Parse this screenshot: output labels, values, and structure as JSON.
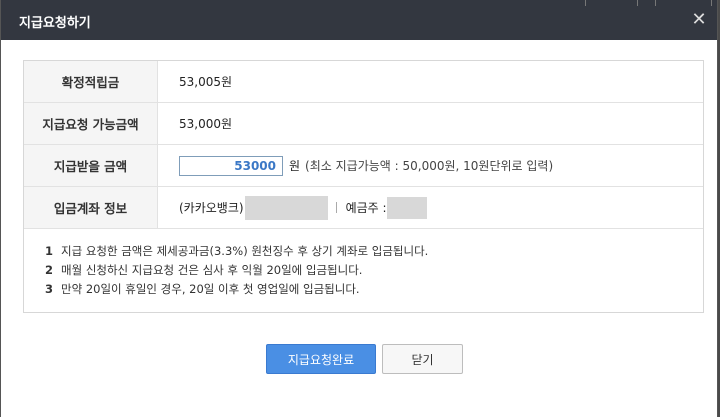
{
  "dialog": {
    "title": "지급요청하기",
    "close_icon": "close-icon"
  },
  "rows": {
    "confirmed": {
      "label": "확정적립금",
      "value": "53,005원"
    },
    "available": {
      "label": "지급요청 가능금액",
      "value": "53,000원"
    },
    "request": {
      "label": "지급받을 금액",
      "input_value": "53000",
      "unit": "원",
      "hint": "(최소 지급가능액 : 50,000원, 10원단위로 입력)"
    },
    "account": {
      "label": "입금계좌 정보",
      "bank": "(카카오뱅크)",
      "holder_label": "예금주 :"
    }
  },
  "notes": [
    {
      "num": "1",
      "text": "지급 요청한 금액은 제세공과금(3.3%) 원천징수 후 상기 계좌로 입금됩니다."
    },
    {
      "num": "2",
      "text": "매월 신청하신 지급요청 건은 심사 후 익월 20일에 입금됩니다."
    },
    {
      "num": "3",
      "text": "만약 20일이 휴일인 경우, 20일 이후 첫 영업일에 입금됩니다."
    }
  ],
  "buttons": {
    "submit": "지급요청완료",
    "close": "닫기"
  },
  "colors": {
    "titlebar": "#333740",
    "primary": "#4a8fe4",
    "input_text": "#3b78c6"
  }
}
